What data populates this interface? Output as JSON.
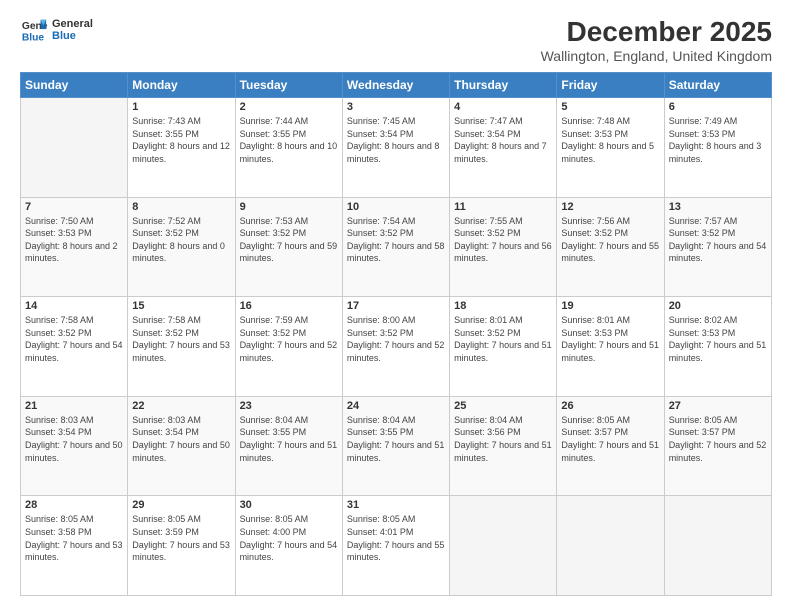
{
  "header": {
    "logo_line1": "General",
    "logo_line2": "Blue",
    "month": "December 2025",
    "location": "Wallington, England, United Kingdom"
  },
  "weekdays": [
    "Sunday",
    "Monday",
    "Tuesday",
    "Wednesday",
    "Thursday",
    "Friday",
    "Saturday"
  ],
  "weeks": [
    [
      {
        "day": "",
        "empty": true
      },
      {
        "day": "1",
        "sunrise": "7:43 AM",
        "sunset": "3:55 PM",
        "daylight": "8 hours and 12 minutes."
      },
      {
        "day": "2",
        "sunrise": "7:44 AM",
        "sunset": "3:55 PM",
        "daylight": "8 hours and 10 minutes."
      },
      {
        "day": "3",
        "sunrise": "7:45 AM",
        "sunset": "3:54 PM",
        "daylight": "8 hours and 8 minutes."
      },
      {
        "day": "4",
        "sunrise": "7:47 AM",
        "sunset": "3:54 PM",
        "daylight": "8 hours and 7 minutes."
      },
      {
        "day": "5",
        "sunrise": "7:48 AM",
        "sunset": "3:53 PM",
        "daylight": "8 hours and 5 minutes."
      },
      {
        "day": "6",
        "sunrise": "7:49 AM",
        "sunset": "3:53 PM",
        "daylight": "8 hours and 3 minutes."
      }
    ],
    [
      {
        "day": "7",
        "sunrise": "7:50 AM",
        "sunset": "3:53 PM",
        "daylight": "8 hours and 2 minutes."
      },
      {
        "day": "8",
        "sunrise": "7:52 AM",
        "sunset": "3:52 PM",
        "daylight": "8 hours and 0 minutes."
      },
      {
        "day": "9",
        "sunrise": "7:53 AM",
        "sunset": "3:52 PM",
        "daylight": "7 hours and 59 minutes."
      },
      {
        "day": "10",
        "sunrise": "7:54 AM",
        "sunset": "3:52 PM",
        "daylight": "7 hours and 58 minutes."
      },
      {
        "day": "11",
        "sunrise": "7:55 AM",
        "sunset": "3:52 PM",
        "daylight": "7 hours and 56 minutes."
      },
      {
        "day": "12",
        "sunrise": "7:56 AM",
        "sunset": "3:52 PM",
        "daylight": "7 hours and 55 minutes."
      },
      {
        "day": "13",
        "sunrise": "7:57 AM",
        "sunset": "3:52 PM",
        "daylight": "7 hours and 54 minutes."
      }
    ],
    [
      {
        "day": "14",
        "sunrise": "7:58 AM",
        "sunset": "3:52 PM",
        "daylight": "7 hours and 54 minutes."
      },
      {
        "day": "15",
        "sunrise": "7:58 AM",
        "sunset": "3:52 PM",
        "daylight": "7 hours and 53 minutes."
      },
      {
        "day": "16",
        "sunrise": "7:59 AM",
        "sunset": "3:52 PM",
        "daylight": "7 hours and 52 minutes."
      },
      {
        "day": "17",
        "sunrise": "8:00 AM",
        "sunset": "3:52 PM",
        "daylight": "7 hours and 52 minutes."
      },
      {
        "day": "18",
        "sunrise": "8:01 AM",
        "sunset": "3:52 PM",
        "daylight": "7 hours and 51 minutes."
      },
      {
        "day": "19",
        "sunrise": "8:01 AM",
        "sunset": "3:53 PM",
        "daylight": "7 hours and 51 minutes."
      },
      {
        "day": "20",
        "sunrise": "8:02 AM",
        "sunset": "3:53 PM",
        "daylight": "7 hours and 51 minutes."
      }
    ],
    [
      {
        "day": "21",
        "sunrise": "8:03 AM",
        "sunset": "3:54 PM",
        "daylight": "7 hours and 50 minutes."
      },
      {
        "day": "22",
        "sunrise": "8:03 AM",
        "sunset": "3:54 PM",
        "daylight": "7 hours and 50 minutes."
      },
      {
        "day": "23",
        "sunrise": "8:04 AM",
        "sunset": "3:55 PM",
        "daylight": "7 hours and 51 minutes."
      },
      {
        "day": "24",
        "sunrise": "8:04 AM",
        "sunset": "3:55 PM",
        "daylight": "7 hours and 51 minutes."
      },
      {
        "day": "25",
        "sunrise": "8:04 AM",
        "sunset": "3:56 PM",
        "daylight": "7 hours and 51 minutes."
      },
      {
        "day": "26",
        "sunrise": "8:05 AM",
        "sunset": "3:57 PM",
        "daylight": "7 hours and 51 minutes."
      },
      {
        "day": "27",
        "sunrise": "8:05 AM",
        "sunset": "3:57 PM",
        "daylight": "7 hours and 52 minutes."
      }
    ],
    [
      {
        "day": "28",
        "sunrise": "8:05 AM",
        "sunset": "3:58 PM",
        "daylight": "7 hours and 53 minutes."
      },
      {
        "day": "29",
        "sunrise": "8:05 AM",
        "sunset": "3:59 PM",
        "daylight": "7 hours and 53 minutes."
      },
      {
        "day": "30",
        "sunrise": "8:05 AM",
        "sunset": "4:00 PM",
        "daylight": "7 hours and 54 minutes."
      },
      {
        "day": "31",
        "sunrise": "8:05 AM",
        "sunset": "4:01 PM",
        "daylight": "7 hours and 55 minutes."
      },
      {
        "day": "",
        "empty": true
      },
      {
        "day": "",
        "empty": true
      },
      {
        "day": "",
        "empty": true
      }
    ]
  ]
}
